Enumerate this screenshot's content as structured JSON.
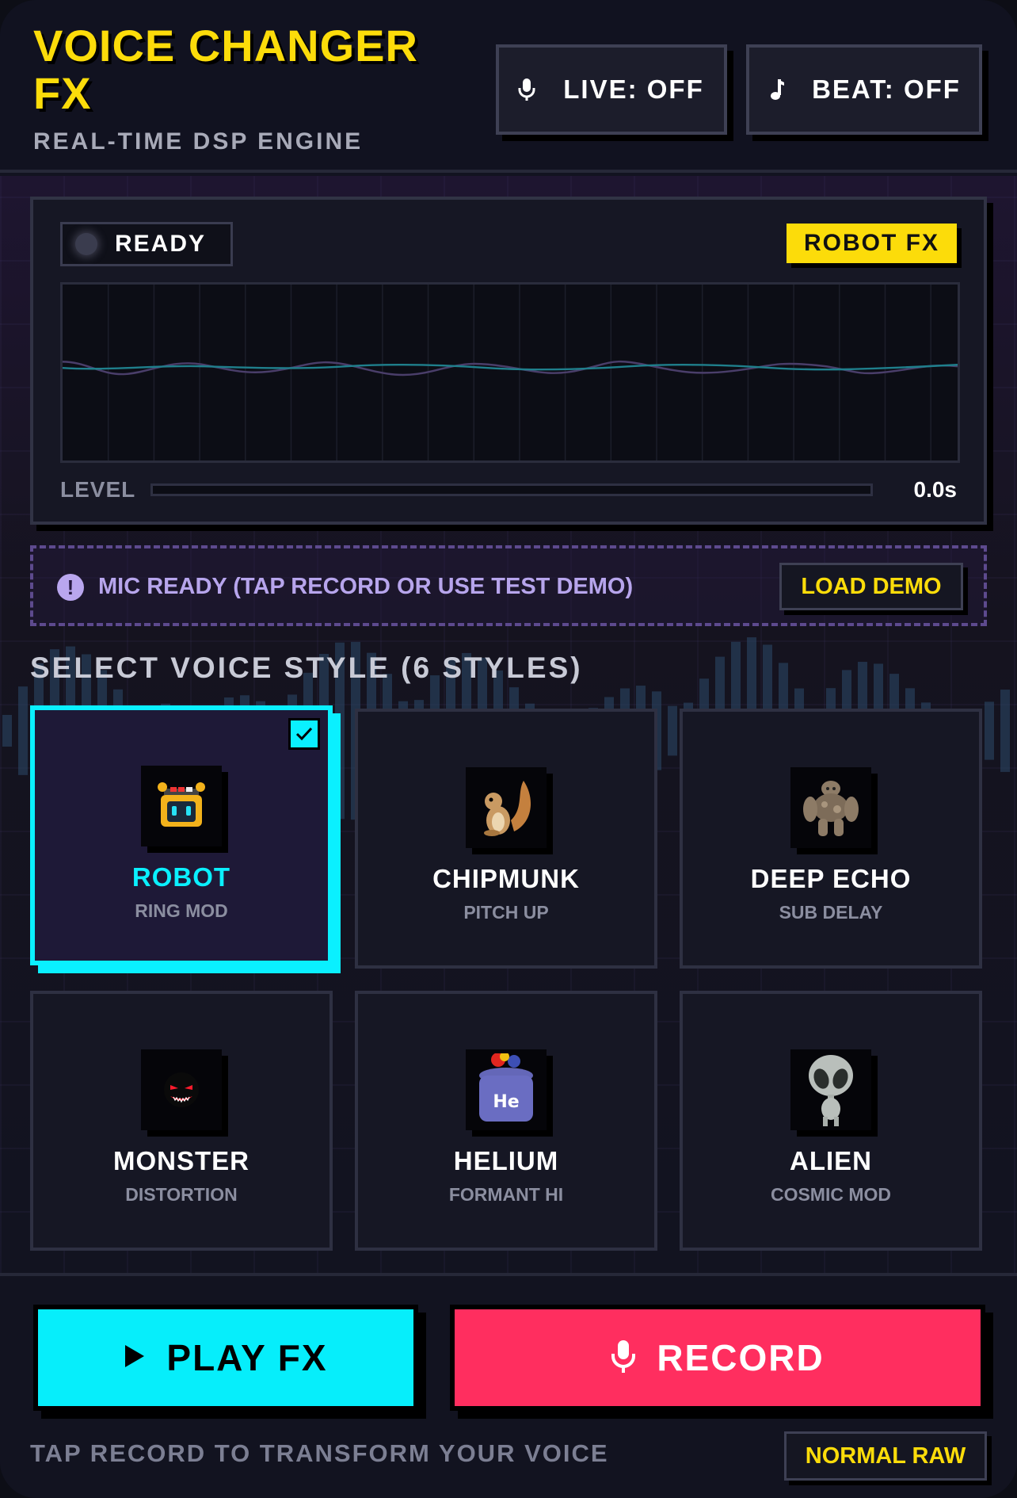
{
  "header": {
    "title": "VOICE CHANGER FX",
    "subtitle": "REAL-TIME DSP ENGINE",
    "live_label": "LIVE: OFF",
    "beat_label": "BEAT: OFF",
    "live_icon": "mic-icon",
    "beat_icon": "music-note-icon"
  },
  "scope": {
    "status": "READY",
    "fx_badge": "ROBOT FX",
    "level_label": "LEVEL",
    "level_value": 0,
    "timer": "0.0s"
  },
  "notice": {
    "icon": "alert-icon",
    "icon_glyph": "!",
    "text": "MIC READY (TAP RECORD OR USE TEST DEMO)",
    "demo_button": "LOAD DEMO"
  },
  "styles": {
    "section_title": "SELECT VOICE STYLE (6 STYLES)",
    "selected": "ROBOT",
    "items": [
      {
        "name": "ROBOT",
        "desc": "RING MOD",
        "icon": "robot-icon"
      },
      {
        "name": "CHIPMUNK",
        "desc": "PITCH UP",
        "icon": "chipmunk-icon"
      },
      {
        "name": "DEEP ECHO",
        "desc": "SUB DELAY",
        "icon": "rock-golem-icon"
      },
      {
        "name": "MONSTER",
        "desc": "DISTORTION",
        "icon": "monster-face-icon"
      },
      {
        "name": "HELIUM",
        "desc": "FORMANT HI",
        "icon": "helium-tank-icon"
      },
      {
        "name": "ALIEN",
        "desc": "COSMIC MOD",
        "icon": "alien-icon"
      }
    ]
  },
  "controls": {
    "play_label": "PLAY FX",
    "record_label": "RECORD",
    "hint": "TAP RECORD TO TRANSFORM YOUR VOICE",
    "raw_button": "NORMAL RAW"
  },
  "colors": {
    "accent_yellow": "#fcdc0a",
    "accent_cyan": "#0af0ff",
    "record_red": "#ff2e5f",
    "notice_purple": "#b7a5ec"
  }
}
